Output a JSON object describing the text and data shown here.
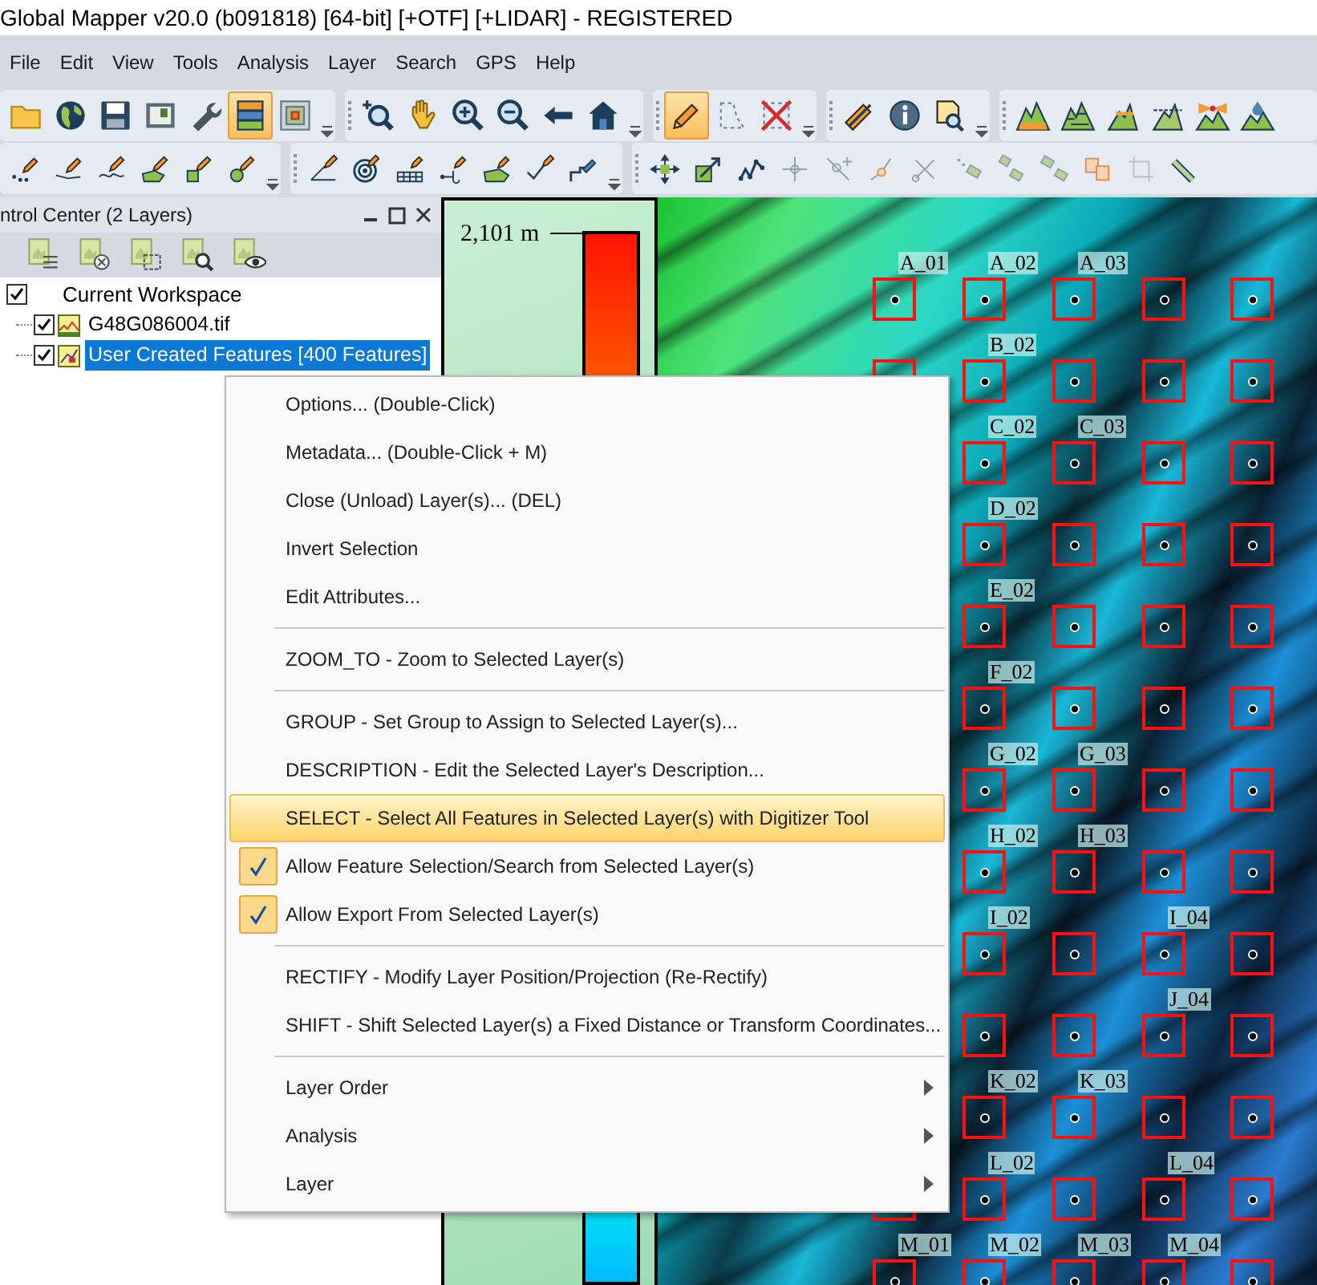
{
  "window": {
    "title": "Global Mapper v20.0 (b091818) [64-bit] [+OTF] [+LIDAR] - REGISTERED"
  },
  "menu_bar": [
    "File",
    "Edit",
    "View",
    "Tools",
    "Analysis",
    "Layer",
    "Search",
    "GPS",
    "Help"
  ],
  "toolbars": [
    {
      "groups": [
        {
          "buttons": [
            {
              "selected": false
            },
            {
              "selected": false
            },
            {
              "selected": false
            },
            {
              "selected": false
            },
            {
              "selected": false
            },
            {
              "selected": true
            },
            {
              "selected": false
            }
          ]
        },
        {
          "buttons": [
            {
              "selected": false
            },
            {
              "selected": false
            },
            {
              "selected": false
            },
            {
              "selected": false
            },
            {
              "selected": false
            },
            {
              "selected": false
            }
          ]
        },
        {
          "buttons": [
            {
              "selected": true
            },
            {
              "selected": false
            },
            {
              "selected": false
            }
          ]
        },
        {
          "buttons": [
            {
              "selected": false
            },
            {
              "selected": false
            },
            {
              "selected": false
            }
          ]
        },
        {
          "buttons": [
            {
              "selected": false
            },
            {
              "selected": false
            },
            {
              "selected": false
            },
            {
              "selected": false
            },
            {
              "selected": false
            },
            {
              "selected": false
            }
          ]
        }
      ]
    },
    {
      "groups": [
        {
          "buttons": [
            {
              "selected": false
            },
            {
              "selected": false
            },
            {
              "selected": false
            },
            {
              "selected": false
            },
            {
              "selected": false
            },
            {
              "selected": false
            }
          ]
        },
        {
          "buttons": [
            {
              "selected": false
            },
            {
              "selected": false
            },
            {
              "selected": false
            },
            {
              "selected": false
            },
            {
              "selected": false
            },
            {
              "selected": false
            },
            {
              "selected": false
            }
          ]
        },
        {
          "buttons": [
            {
              "selected": false
            },
            {
              "selected": false
            },
            {
              "selected": false
            },
            {
              "selected": false
            },
            {
              "selected": false
            },
            {
              "selected": false
            },
            {
              "selected": false
            },
            {
              "selected": false
            },
            {
              "selected": false
            },
            {
              "selected": false
            },
            {
              "selected": false
            },
            {
              "selected": false
            },
            {
              "selected": false
            }
          ]
        }
      ]
    }
  ],
  "control_center": {
    "title": "ntrol Center (2 Layers)",
    "tree": [
      {
        "label": "Current Workspace",
        "checked": true,
        "selected": false,
        "children": [
          {
            "label": "G48G086004.tif",
            "checked": true,
            "selected": false
          },
          {
            "label": "User Created Features [400 Features]",
            "checked": true,
            "selected": true
          }
        ]
      }
    ]
  },
  "legend": {
    "max_label": "2,101 m"
  },
  "map": {
    "feature_rows": [
      [
        "A_01",
        "A_02",
        "A_03",
        null,
        null
      ],
      [
        null,
        "B_02",
        null,
        null,
        null
      ],
      [
        null,
        "C_02",
        "C_03",
        null,
        null
      ],
      [
        null,
        "D_02",
        null,
        null,
        null
      ],
      [
        null,
        "E_02",
        null,
        null,
        null
      ],
      [
        null,
        "F_02",
        null,
        null,
        null
      ],
      [
        null,
        "G_02",
        "G_03",
        null,
        null
      ],
      [
        null,
        "H_02",
        "H_03",
        null,
        null
      ],
      [
        null,
        "I_02",
        null,
        "I_04",
        null
      ],
      [
        null,
        null,
        null,
        "J_04",
        null
      ],
      [
        null,
        "K_02",
        "K_03",
        null,
        null
      ],
      [
        null,
        "L_02",
        null,
        "L_04",
        null
      ],
      [
        "M_01",
        "M_02",
        "M_03",
        "M_04",
        null
      ]
    ]
  },
  "context_menu": {
    "items": [
      {
        "kind": "item",
        "label": "Options... (Double-Click)",
        "checked": false,
        "selected": false,
        "submenu": false
      },
      {
        "kind": "item",
        "label": "Metadata... (Double-Click + M)",
        "checked": false,
        "selected": false,
        "submenu": false
      },
      {
        "kind": "item",
        "label": "Close (Unload) Layer(s)... (DEL)",
        "checked": false,
        "selected": false,
        "submenu": false
      },
      {
        "kind": "item",
        "label": "Invert Selection",
        "checked": false,
        "selected": false,
        "submenu": false
      },
      {
        "kind": "item",
        "label": "Edit Attributes...",
        "checked": false,
        "selected": false,
        "submenu": false
      },
      {
        "kind": "separator"
      },
      {
        "kind": "item",
        "label": "ZOOM_TO - Zoom to Selected Layer(s)",
        "checked": false,
        "selected": false,
        "submenu": false
      },
      {
        "kind": "separator"
      },
      {
        "kind": "item",
        "label": "GROUP - Set Group to Assign to Selected Layer(s)...",
        "checked": false,
        "selected": false,
        "submenu": false
      },
      {
        "kind": "item",
        "label": "DESCRIPTION - Edit the Selected Layer's Description...",
        "checked": false,
        "selected": false,
        "submenu": false
      },
      {
        "kind": "item",
        "label": "SELECT - Select All Features in Selected Layer(s) with Digitizer Tool",
        "checked": false,
        "selected": true,
        "submenu": false
      },
      {
        "kind": "item",
        "label": "Allow Feature Selection/Search from Selected Layer(s)",
        "checked": true,
        "selected": false,
        "submenu": false
      },
      {
        "kind": "item",
        "label": "Allow Export From Selected Layer(s)",
        "checked": true,
        "selected": false,
        "submenu": false
      },
      {
        "kind": "separator"
      },
      {
        "kind": "item",
        "label": "RECTIFY - Modify Layer Position/Projection (Re-Rectify)",
        "checked": false,
        "selected": false,
        "submenu": false
      },
      {
        "kind": "item",
        "label": "SHIFT - Shift Selected Layer(s) a Fixed Distance or Transform Coordinates...",
        "checked": false,
        "selected": false,
        "submenu": false
      },
      {
        "kind": "separator"
      },
      {
        "kind": "item",
        "label": "Layer Order",
        "checked": false,
        "selected": false,
        "submenu": true
      },
      {
        "kind": "item",
        "label": "Analysis",
        "checked": false,
        "selected": false,
        "submenu": true
      },
      {
        "kind": "item",
        "label": "Layer",
        "checked": false,
        "selected": false,
        "submenu": true
      }
    ]
  }
}
